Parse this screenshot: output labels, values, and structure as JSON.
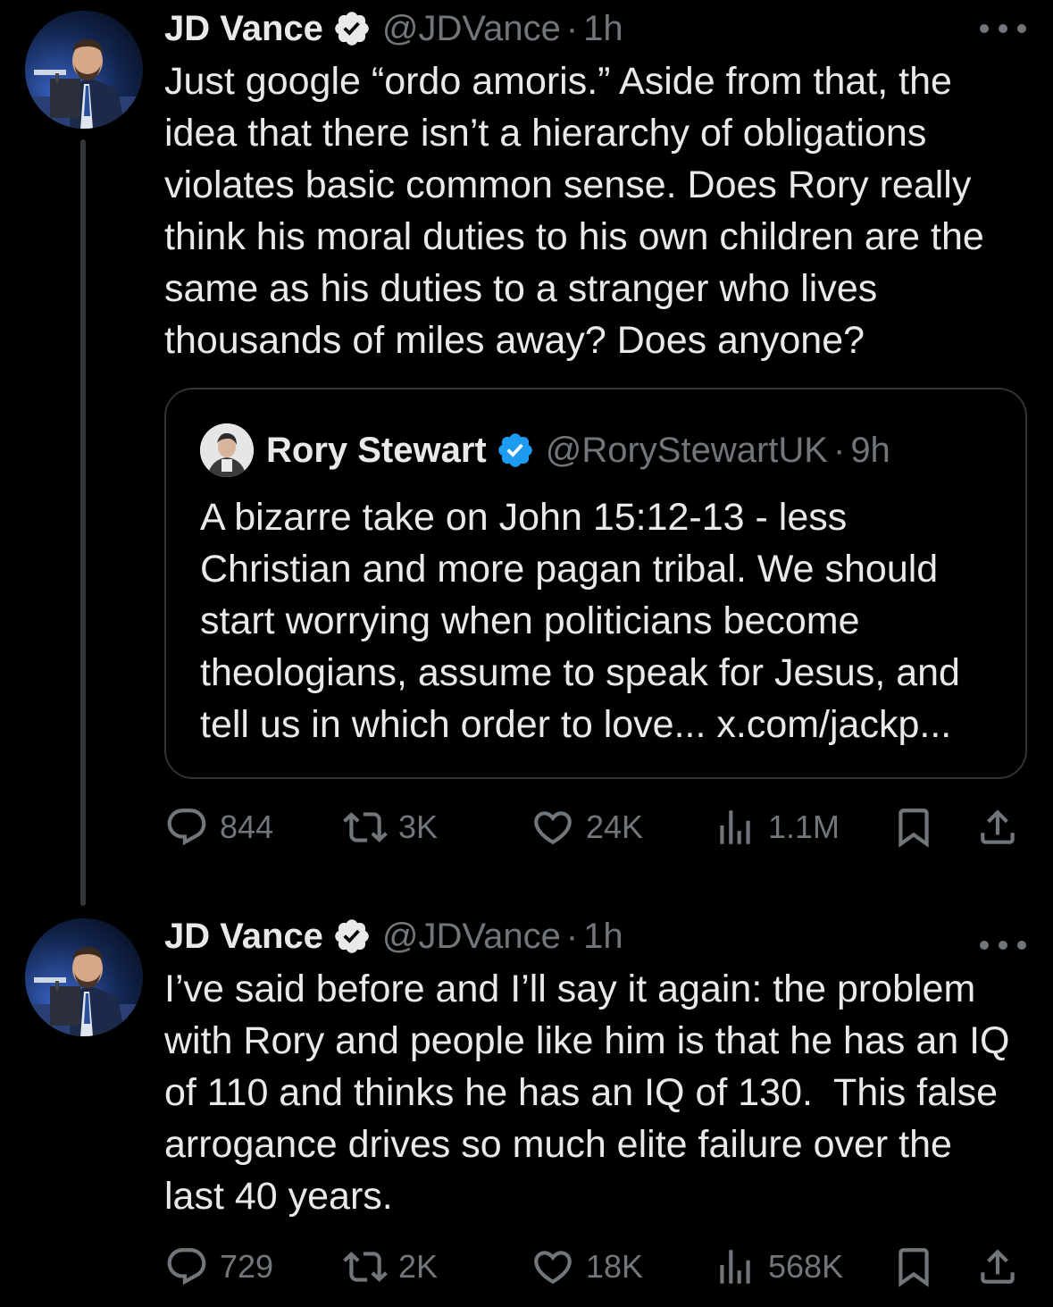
{
  "tweets": [
    {
      "author": {
        "name": "JD Vance",
        "handle": "@JDVance",
        "verified": true
      },
      "time": "1h",
      "separator": "·",
      "text": "Just google “ordo amoris.” Aside from that, the idea that there isn’t a hierarchy of obligations violates basic common sense. Does Rory really think his moral duties to his own children are the same as his duties to a stranger who lives thousands of miles away? Does anyone?",
      "quote": {
        "author": {
          "name": "Rory Stewart",
          "handle": "@RoryStewartUK",
          "verified": true
        },
        "time": "9h",
        "separator": "·",
        "text": "A bizarre take on John 15:12-13  - less Christian and more pagan tribal. We should start worrying when politicians become theologians, assume to speak for Jesus, and tell us in which order to love... x.com/jackp..."
      },
      "stats": {
        "replies": "844",
        "reposts": "3K",
        "likes": "24K",
        "views": "1.1M"
      }
    },
    {
      "author": {
        "name": "JD Vance",
        "handle": "@JDVance",
        "verified": true
      },
      "time": "1h",
      "separator": "·",
      "text": "I’ve said before and I’ll say it again: the problem with Rory and people like him is that he has an IQ of 110 and thinks he has an IQ of 130.  This false arrogance drives so much elite failure over the last 40 years.",
      "stats": {
        "replies": "729",
        "reposts": "2K",
        "likes": "18K",
        "views": "568K"
      }
    }
  ],
  "colors": {
    "background": "#000000",
    "text_primary": "#e7e9ea",
    "text_secondary": "#71767b",
    "verified_badge": "#1d9bf0",
    "border": "#2f3336"
  },
  "icons": [
    "verified-badge-icon",
    "more-options-icon",
    "reply-icon",
    "repost-icon",
    "like-icon",
    "views-icon",
    "bookmark-icon",
    "share-icon"
  ]
}
